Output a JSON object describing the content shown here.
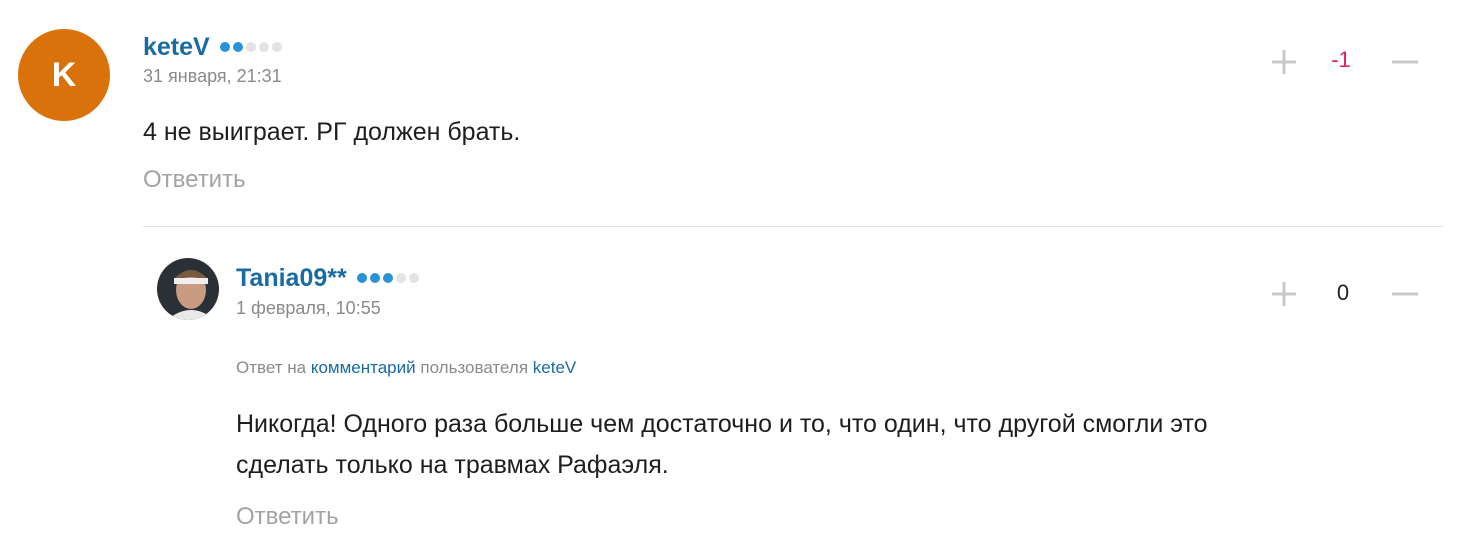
{
  "comment": {
    "avatar_letter": "K",
    "author": "keteV",
    "rank_dots": [
      true,
      true,
      false,
      false,
      false
    ],
    "timestamp": "31 января, 21:31",
    "text": "4 не выиграет. РГ должен брать.",
    "reply_label": "Ответить",
    "score": "-1",
    "score_color": "#e0245e"
  },
  "reply": {
    "author": "Tania09**",
    "rank_dots": [
      true,
      true,
      true,
      false,
      false
    ],
    "timestamp": "1 февраля, 10:55",
    "reply_prefix": "Ответ на",
    "reply_comment_link": "комментарий",
    "reply_user_word": "пользователя",
    "reply_user": "keteV",
    "text_line1": "Никогда! Одного раза больше чем достаточно и то, что один, что другой смогли это",
    "text_line2": "сделать только на травмах Рафаэля.",
    "reply_label": "Ответить",
    "score": "0",
    "score_color": "#222222"
  },
  "colors": {
    "accent": "#1a6ba3",
    "rank_dot_active": "#2a93d5",
    "avatar_bg": "#d9720b"
  }
}
